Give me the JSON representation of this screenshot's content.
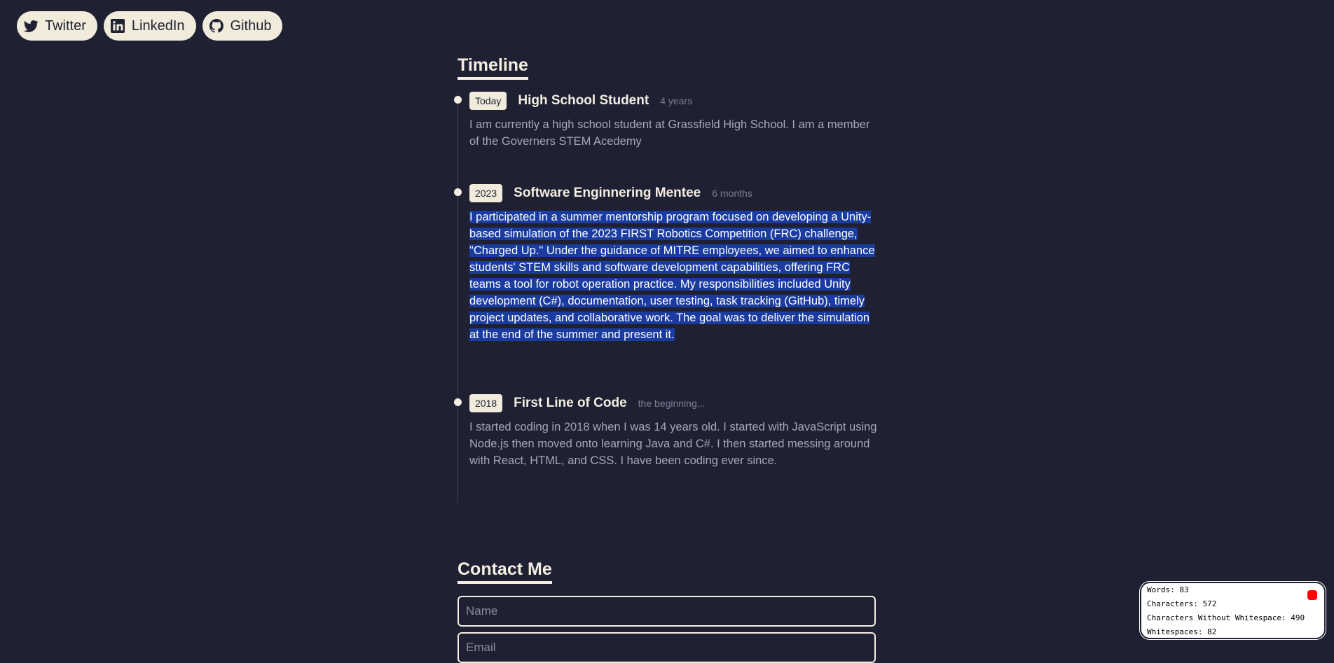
{
  "social": [
    {
      "label": "Twitter",
      "icon": "twitter-icon"
    },
    {
      "label": "LinkedIn",
      "icon": "linkedin-icon"
    },
    {
      "label": "Github",
      "icon": "github-icon"
    }
  ],
  "timeline": {
    "title": "Timeline",
    "entries": [
      {
        "badge": "Today",
        "title": "High School Student",
        "duration": "4 years",
        "description": "I am currently a high school student at Grassfield High School. I am a member of the Governers STEM Acedemy"
      },
      {
        "badge": "2023",
        "title": "Software Enginnering Mentee",
        "duration": "6 months",
        "description": "I participated in a summer mentorship program focused on developing a Unity-based simulation of the 2023 FIRST Robotics Competition (FRC) challenge, \"Charged Up.\" Under the guidance of MITRE employees, we aimed to enhance students' STEM skills and software development capabilities, offering FRC teams a tool for robot operation practice. My responsibilities included Unity development (C#), documentation, user testing, task tracking (GitHub), timely project updates, and collaborative work. The goal was to deliver the simulation at the end of the summer and present it."
      },
      {
        "badge": "2018",
        "title": "First Line of Code",
        "duration": "the beginning...",
        "description": "I started coding in 2018 when I was 14 years old. I started with JavaScript using Node.js then moved onto learning Java and C#. I then started messing around with React, HTML, and CSS. I have been coding ever since."
      }
    ]
  },
  "contact": {
    "title": "Contact Me",
    "name_placeholder": "Name",
    "email_placeholder": "Email"
  },
  "word_counter": {
    "words": "Words: 83",
    "characters": "Characters: 572",
    "characters_no_ws": "Characters Without Whitespace: 490",
    "whitespaces": "Whitespaces: 82"
  },
  "colors": {
    "background": "#1f2133",
    "accent": "#f1ebdc",
    "selection": "#1a3b9f",
    "close": "#ff0000"
  }
}
